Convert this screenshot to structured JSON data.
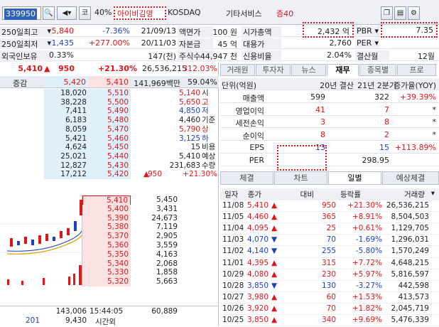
{
  "top": {
    "code": "339950",
    "market_badge": "코",
    "pct": "40%",
    "name": "아이비김영",
    "market": "KOSDAQ",
    "sector": "기타서비스",
    "deposit": "증40"
  },
  "info": {
    "r1": {
      "label": "250일최고",
      "price": "5,840",
      "change": "-7.36%",
      "date": "21/09/13",
      "face_label": "액면가",
      "face": "100 원",
      "cap_label": "시가총액",
      "cap": "2,432 억",
      "pbr_label": "PBR",
      "pbr": "7.35"
    },
    "r2": {
      "label": "250일최저",
      "price": "1,435",
      "change": "+277.00%",
      "date": "20/11/03",
      "capital_label": "자본금",
      "capital": "45 억",
      "sub_label": "대용가",
      "sub": "2,760",
      "per_label": "PER",
      "per": ""
    },
    "r3": {
      "label": "외국인보유",
      "ratio": "0.33%",
      "shares": "147(천)",
      "shares_label": "주식수",
      "shares_total": "44,947 천",
      "credit_label": "신용비율",
      "credit": "2.04%",
      "settle_label": "결산월",
      "settle": "12월"
    }
  },
  "quote": {
    "price": "5,410",
    "arrow": "▲",
    "change": "950",
    "pct": "+21.30%",
    "volume": "26,536,215",
    "vol_pct": "312.03%",
    "hdr_left": "증감",
    "hdr_ask": "5,420",
    "hdr_bid": "5,410",
    "hdr_amount": "141,969백만",
    "hdr_ratio": "59.04%",
    "asks": [
      [
        "18,020",
        "5,510"
      ],
      [
        "38,228",
        "5,500"
      ],
      [
        "7,411",
        "5,490"
      ],
      [
        "6,183",
        "5,480"
      ],
      [
        "8,059",
        "5,470"
      ],
      [
        "5,421",
        "5,460"
      ],
      [
        "4,624",
        "5,450"
      ],
      [
        "25,021",
        "5,440"
      ],
      [
        "12,827",
        "5,430"
      ],
      [
        "17,212",
        "5,420"
      ]
    ],
    "side": [
      [
        "5,140",
        "시"
      ],
      [
        "5,650",
        "고"
      ],
      [
        "4,850",
        "저"
      ],
      [
        "4,460",
        "기준"
      ],
      [
        "5,790",
        "상"
      ],
      [
        "3,125",
        "하"
      ],
      [
        "15",
        "비용"
      ],
      [
        "5,410",
        "예상"
      ],
      [
        "231,683",
        "수량"
      ]
    ],
    "side_last": {
      "arrow": "▲",
      "change": "950",
      "pct": "+21.30%"
    },
    "bids": [
      [
        "5,410",
        "5,450"
      ],
      [
        "5,400",
        "3,431"
      ],
      [
        "5,390",
        "24,673"
      ],
      [
        "5,380",
        "7,119"
      ],
      [
        "5,370",
        "2,905"
      ],
      [
        "5,360",
        "3,559"
      ],
      [
        "5,350",
        "4,163"
      ],
      [
        "5,340",
        "2,068"
      ],
      [
        "5,330",
        "1,858"
      ],
      [
        "5,320",
        "5,663"
      ]
    ],
    "foot1": {
      "ask_total": "143,006",
      "time": "15:44:05",
      "bid_total": "60,889"
    },
    "foot2": {
      "left": "201",
      "ask": "9,430",
      "label": "시간외"
    }
  },
  "tabs": [
    "거래원",
    "투자자",
    "뉴스",
    "재무",
    "종목별",
    "프로"
  ],
  "fin": {
    "headers": [
      "단위(억원)",
      "20년 결산",
      "21년 2분기",
      "증가율(YOY)"
    ],
    "rows": [
      [
        "매출액",
        "599",
        "322",
        "+39.39%"
      ],
      [
        "영업이익",
        "41",
        "7",
        "*"
      ],
      [
        "세전손익",
        "3",
        "8",
        "*"
      ],
      [
        "순이익",
        "8",
        "2",
        "*"
      ],
      [
        "EPS",
        "13",
        "15",
        "+113.89%"
      ],
      [
        "PER",
        "",
        "298.95",
        ""
      ]
    ]
  },
  "subtabs": [
    "체결",
    "차트",
    "일별",
    "예상체결"
  ],
  "daily": {
    "headers": [
      "일자",
      "종가",
      "대비",
      "등락률",
      "거래량"
    ],
    "rows": [
      [
        "11/08",
        "5,410",
        "▲",
        "950",
        "+21.30%",
        "26,536,215",
        "r"
      ],
      [
        "11/05",
        "4,460",
        "▲",
        "365",
        "+8.91%",
        "8,504,503",
        "r"
      ],
      [
        "11/04",
        "4,095",
        "▲",
        "25",
        "+0.61%",
        "1,129,705",
        "r"
      ],
      [
        "11/03",
        "4,070",
        "▼",
        "70",
        "-1.69%",
        "1,296,031",
        "b"
      ],
      [
        "11/02",
        "4,140",
        "▼",
        "255",
        "-5.80%",
        "1,570,249",
        "b"
      ],
      [
        "11/01",
        "4,395",
        "▲",
        "315",
        "+7.72%",
        "4,648,215",
        "r"
      ],
      [
        "10/29",
        "4,080",
        "▲",
        "230",
        "+5.97%",
        "5,816,597",
        "r"
      ],
      [
        "10/28",
        "3,850",
        "▼",
        "130",
        "-3.27%",
        "442,598",
        "b"
      ],
      [
        "10/27",
        "3,980",
        "▲",
        "60",
        "+1.53%",
        "413,573",
        "r"
      ],
      [
        "10/26",
        "3,920",
        "▲",
        "70",
        "+1.82%",
        "2,045,719",
        "r"
      ],
      [
        "10/25",
        "3,850",
        "▲",
        "340",
        "+9.69%",
        "5,476,339",
        "r"
      ]
    ]
  }
}
